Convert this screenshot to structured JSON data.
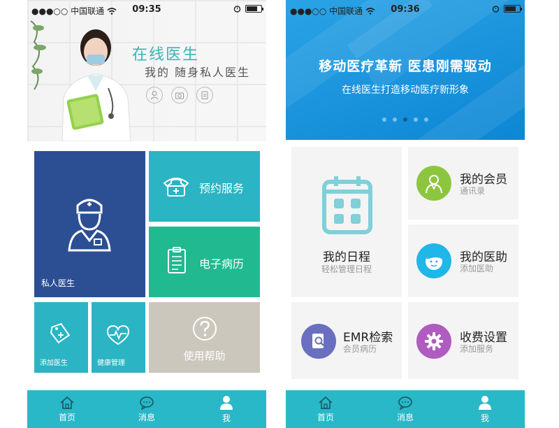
{
  "left": {
    "status_bar": {
      "carrier": "●●●○○ 中国联通",
      "time": "09:35"
    },
    "banner": {
      "title": "在线医生",
      "subtitle": "我的 随身私人医生"
    },
    "tiles": {
      "private_doctor": "私人医生",
      "appointment": "预约服务",
      "emr": "电子病历",
      "add_doctor": "添加医生",
      "health": "健康管理",
      "help": "使用帮助"
    },
    "colors": {
      "navy": "#2c4f93",
      "teal": "#2bb4c3",
      "green": "#21b990",
      "gray": "#ccc7bd"
    }
  },
  "right": {
    "status_bar": {
      "carrier": "●●●○○ 中国联通",
      "time": "09:36"
    },
    "banner": {
      "headline": "移动医疗革新   医患刚需驱动",
      "subline": "在线医生打造移动医疗新形象",
      "active_dot": 3,
      "dots": 5
    },
    "cards": {
      "schedule": {
        "title": "我的日程",
        "sub": "轻松管理日程"
      },
      "members": {
        "title": "我的会员",
        "sub": "通讯录"
      },
      "assistant": {
        "title": "我的医助",
        "sub": "添加医助"
      },
      "emr": {
        "title": "EMR检索",
        "sub": "会员病历"
      },
      "fees": {
        "title": "收费设置",
        "sub": "添加服务"
      }
    },
    "colors": {
      "members": "#8cc63f",
      "assistant": "#1fb6e8",
      "emr": "#6a6fc0",
      "fees": "#b05bc0",
      "calendar": "#7fd0d8"
    }
  },
  "tabbar": {
    "home": "首页",
    "messages": "消息",
    "me": "我"
  }
}
